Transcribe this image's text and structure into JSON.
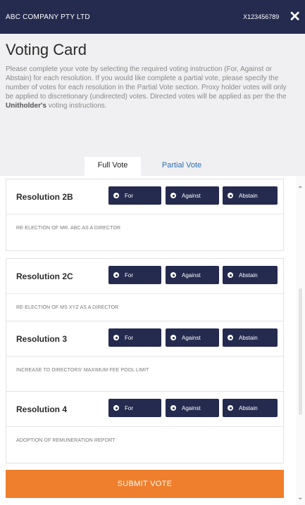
{
  "header": {
    "company": "ABC COMPANY PTY LTD",
    "account_id": "X123456789",
    "close_glyph": "✕"
  },
  "card_title": "Voting Card",
  "instructions": {
    "part1": "Please complete your vote by selecting the required voting instruction (For, Against or Abstain) for each resolution. If you would like complete a partial vote, please specify the number of votes for each resolution in the Partial Vote section. Proxy holder votes will only be applied to discretionary (undirected) votes. Directed votes will be applied as per the the ",
    "bold": "Unitholder's",
    "part2": " voting instructions."
  },
  "tabs": {
    "full": "Full Vote",
    "partial": "Partial Vote"
  },
  "buttons": {
    "for": "For",
    "against": "Against",
    "abstain": "Abstain"
  },
  "resolutions": [
    {
      "title": "Resolution 2B",
      "description": "RE-ELECTION OF MR. ABC AS A DIRECTOR"
    },
    {
      "title": "Resolution 2C",
      "description": "RE-ELECTION OF MS XYZ AS A DIRECTOR"
    },
    {
      "title": "Resolution 3",
      "description": "INCREASE TO DIRECTORS' MAXIMUM FEE POOL LIMIT"
    },
    {
      "title": "Resolution 4",
      "description": "ADOPTION OF REMUNERATION REPORT"
    }
  ],
  "submit_label": "SUBMIT VOTE",
  "colors": {
    "navy": "#252a4f",
    "accent_orange": "#ef7e2d",
    "link_blue": "#2e6db3"
  }
}
